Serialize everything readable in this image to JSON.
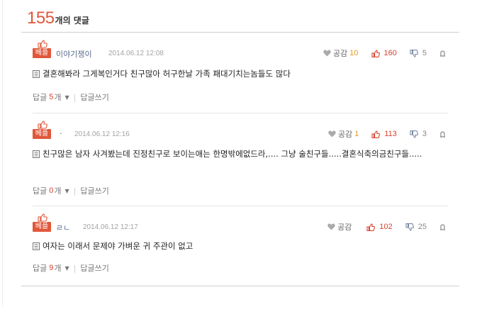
{
  "header": {
    "count": "155",
    "count_label": "개의 댓글"
  },
  "labels": {
    "best_badge": "베플",
    "like": "공감",
    "replies": "답글",
    "replies_unit": "개",
    "write_reply": "답글쓰기"
  },
  "comments": [
    {
      "author": "이야기쟁이",
      "date": "2014.06.12 12:08",
      "likes": "10",
      "upvotes": "160",
      "downvotes": "5",
      "text": "결혼해봐라 그게복인거다 친구많아 허구한날 가족 패대기치는놈들도 많다",
      "reply_count": "5"
    },
    {
      "author": "·",
      "date": "2014.06.12 12:16",
      "likes": "1",
      "upvotes": "113",
      "downvotes": "3",
      "text": "친구많은 남자 사겨봤는데 진정친구로 보이는애는 한명밖에없드라,.... 그냥 술친구들.....결혼식축의금친구들.....",
      "reply_count": "0"
    },
    {
      "author": "ㄹㄴ",
      "date": "2014.06.12 12:17",
      "likes": "",
      "upvotes": "102",
      "downvotes": "25",
      "text": "여자는 이래서 문제야 가벼운 귀 주관이 없고",
      "reply_count": "9"
    }
  ],
  "colors": {
    "accent": "#e0573a",
    "author": "#5a6b8c",
    "count_red": "#d8412f",
    "like_orange": "#e89a1e"
  },
  "icons": [
    "thumbs-up-icon",
    "heart-icon",
    "upvote-icon",
    "downvote-icon",
    "report-icon",
    "document-icon",
    "chevron-down-icon"
  ]
}
